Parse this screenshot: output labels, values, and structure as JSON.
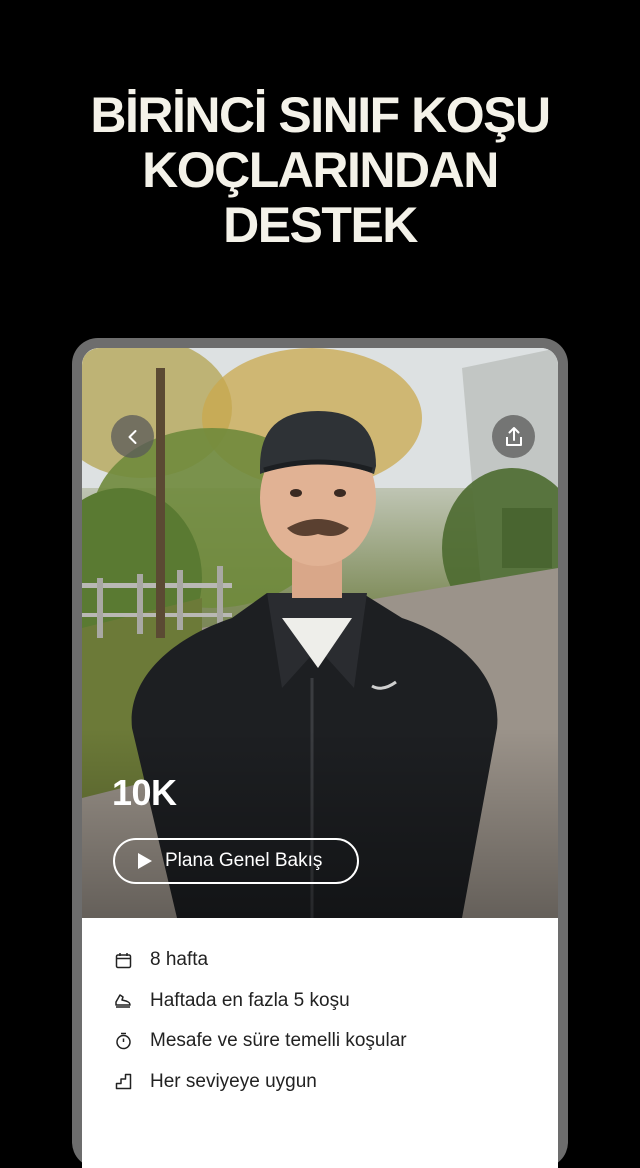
{
  "headline": {
    "line1": "BİRİNCİ SINIF KOŞU",
    "line2": "KOÇLARINDAN",
    "line3": "DESTEK"
  },
  "hero": {
    "back_icon": "chevron-left-icon",
    "share_icon": "share-icon",
    "plan_title": "10K",
    "overview_label": "Plana Genel Bakış",
    "overview_icon": "play-icon"
  },
  "details": [
    {
      "icon": "calendar-icon",
      "text": "8 hafta"
    },
    {
      "icon": "shoe-icon",
      "text": "Haftada en fazla 5 koşu"
    },
    {
      "icon": "stopwatch-icon",
      "text": "Mesafe ve süre temelli koşular"
    },
    {
      "icon": "steps-icon",
      "text": "Her seviyeye uygun"
    }
  ]
}
